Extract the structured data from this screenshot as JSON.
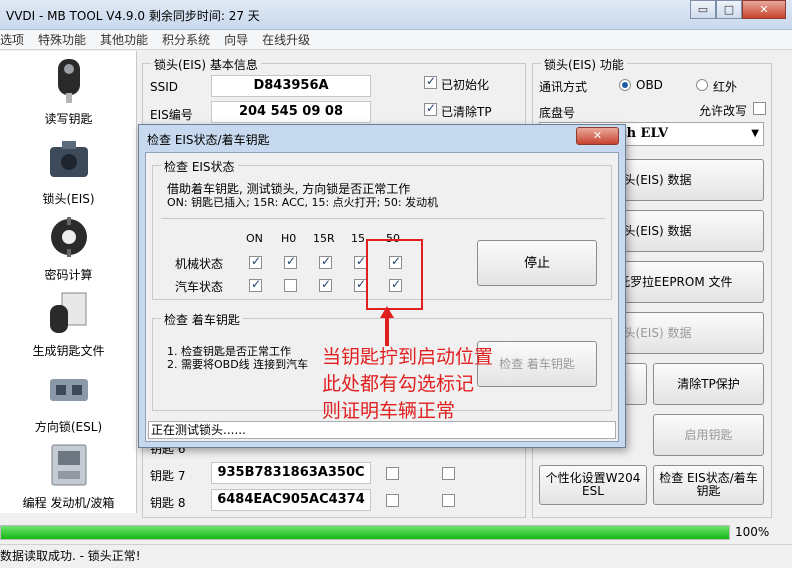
{
  "window": {
    "title": "VVDI - MB TOOL V4.9.0   剩余同步时间: 27 天",
    "minimize": "▭",
    "maximize": "□",
    "close": "✕"
  },
  "menu": [
    "选项",
    "特殊功能",
    "其他功能",
    "积分系统",
    "向导",
    "在线升级"
  ],
  "sidebar": [
    {
      "label": "读写钥匙",
      "icon": "car-key-icon"
    },
    {
      "label": "锁头(EIS)",
      "icon": "eis-module-icon"
    },
    {
      "label": "密码计算",
      "icon": "password-calc-icon"
    },
    {
      "label": "生成钥匙文件",
      "icon": "key-file-icon"
    },
    {
      "label": "方向锁(ESL)",
      "icon": "steering-lock-icon"
    },
    {
      "label": "编程 发动机/波箱",
      "icon": "ecu-module-icon"
    }
  ],
  "eis_info": {
    "title": "锁头(EIS) 基本信息",
    "ssid_label": "SSID",
    "ssid_value": "D843956A",
    "eis_no_label": "EIS编号",
    "eis_no_value": "204 545 09 08",
    "initialized_label": "已初始化",
    "tp_cleared_label": "已清除TP",
    "key6_label": "钥匙 6",
    "key7_label": "钥匙 7",
    "key7_value": "935B7831863A350C",
    "key8_label": "钥匙 8",
    "key8_value": "6484EAC905AC4374"
  },
  "eis_func": {
    "title": "锁头(EIS) 功能",
    "comm_label": "通讯方式",
    "obd_label": "OBD",
    "ir_label": "红外",
    "chassis_label": "底盘号",
    "allow_modify_label": "允许改写",
    "chassis_value": "07, 212(with ELV",
    "btn_read": "锁头(EIS) 数据",
    "btn_write": "锁头(EIS) 数据",
    "btn_eeprom": "数据 / 摩托罗拉EEPROM 文件",
    "btn_disabled1": "锁头(EIS) 数据",
    "btn_partial": ")",
    "btn_clear_tp": "清除TP保护",
    "btn_enable_key": "启用钥匙",
    "btn_w204": "个性化设置W204 ESL",
    "btn_check": "检查 EIS状态/着车钥匙"
  },
  "progress": {
    "value": 100,
    "text": "100%"
  },
  "status": "数据读取成功. - 锁头正常!",
  "dialog": {
    "title": "检查 EIS状态/着车钥匙",
    "close": "✕",
    "group1_title": "检查 EIS状态",
    "desc1": "借助着车钥匙, 测试锁头, 方向锁是否正常工作",
    "desc2": "ON: 钥匙已插入; 15R: ACC, 15: 点火打开; 50: 发动机",
    "columns": [
      "ON",
      "H0",
      "15R",
      "15",
      "50"
    ],
    "rows": [
      {
        "label": "机械状态",
        "checks": [
          true,
          true,
          true,
          true,
          true
        ]
      },
      {
        "label": "汽车状态",
        "checks": [
          true,
          false,
          true,
          true,
          true
        ]
      }
    ],
    "stop": "停止",
    "group2_title": "检查 着车钥匙",
    "item1": "1. 检查钥匙是否正常工作",
    "item2": "2. 需要将OBD线 连接到汽车",
    "check_key_btn": "检查 着车钥匙",
    "status": "正在测试锁头......"
  },
  "annotation": {
    "line1": "当钥匙拧到启动位置",
    "line2": "此处都有勾选标记",
    "line3": "则证明车辆正常"
  }
}
